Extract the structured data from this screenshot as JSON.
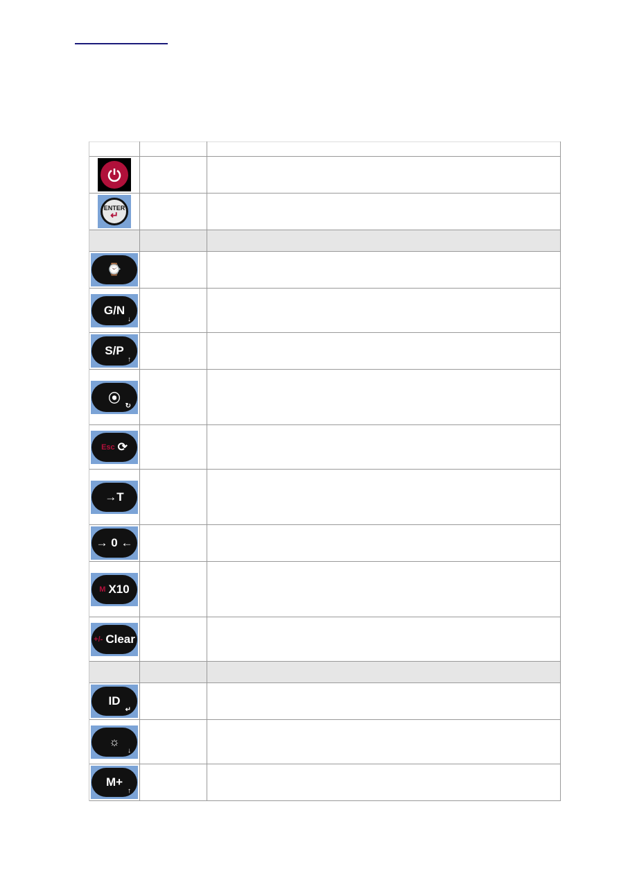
{
  "page": {
    "top_link": ""
  },
  "table": {
    "header": [
      "",
      "",
      ""
    ],
    "rows": [
      {
        "type": "key",
        "icon": "power-icon",
        "label": "",
        "col2": "",
        "col3": ""
      },
      {
        "type": "key",
        "icon": "enter-icon",
        "label": "ENTER",
        "col2": "",
        "col3": ""
      },
      {
        "type": "section",
        "col1": "",
        "col2": "",
        "col3": ""
      },
      {
        "type": "key",
        "icon": "clock-return-icon",
        "label": "⌚",
        "col2": "",
        "col3": ""
      },
      {
        "type": "key",
        "icon": "gross-net-key-icon",
        "label": "G/N",
        "sub": "↓",
        "col2": "",
        "col3": ""
      },
      {
        "type": "key",
        "icon": "sp-key-icon",
        "label": "S/P",
        "sub": "↑",
        "col2": "",
        "col3": ""
      },
      {
        "type": "key",
        "icon": "print-roll-icon",
        "label": "⦿",
        "sub": "↻",
        "col2": "",
        "col3": ""
      },
      {
        "type": "key",
        "icon": "esc-cycle-icon",
        "label": "⟳",
        "red": "Esc",
        "col2": "",
        "col3": ""
      },
      {
        "type": "key",
        "icon": "tare-lock-icon",
        "label": "→T",
        "col2": "",
        "col3": ""
      },
      {
        "type": "key",
        "icon": "zero-key-icon",
        "label": "→ 0 ←",
        "col2": "",
        "col3": ""
      },
      {
        "type": "key",
        "icon": "x10-key-icon",
        "label": "X10",
        "red": "M",
        "col2": "",
        "col3": ""
      },
      {
        "type": "key",
        "icon": "clear-key-icon",
        "label": "Clear",
        "red": "+/-",
        "col2": "",
        "col3": ""
      },
      {
        "type": "section",
        "col1": "",
        "col2": "",
        "col3": ""
      },
      {
        "type": "key",
        "icon": "id-key-icon",
        "label": "ID",
        "sub": "↵",
        "col2": "",
        "col3": ""
      },
      {
        "type": "key",
        "icon": "brightness-key-icon",
        "label": "☼",
        "sub": "↓",
        "col2": "",
        "col3": ""
      },
      {
        "type": "key",
        "icon": "m-plus-key-icon",
        "label": "M+",
        "sub": "↑",
        "col2": "",
        "col3": ""
      }
    ]
  }
}
